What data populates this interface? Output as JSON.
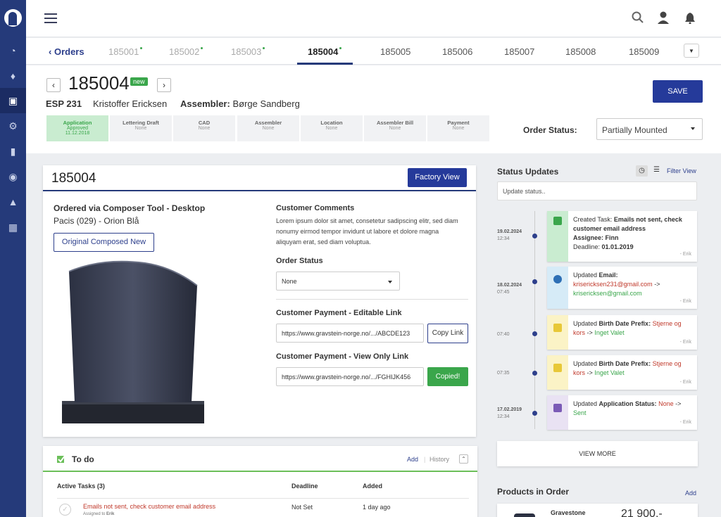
{
  "topbar": {
    "menu_icon": "hamburger-icon",
    "icons": [
      "search-icon",
      "user-icon",
      "bell-icon"
    ]
  },
  "sidebar": {
    "icons": [
      "dashboard-icon",
      "bell-icon",
      "cart-icon",
      "settings-icon",
      "book-icon",
      "support-icon",
      "box-icon",
      "building-icon"
    ]
  },
  "tabs": {
    "back_label": "Orders",
    "items": [
      "185001",
      "185002",
      "185003",
      "185004",
      "185005",
      "185006",
      "185007",
      "185008",
      "185009"
    ],
    "active": "185004"
  },
  "header": {
    "order_id": "185004",
    "badge": "new",
    "product_code": "ESP 231",
    "customer": "Kristoffer Ericksen",
    "assembler_label": "Assembler:",
    "assembler_name": "Børge Sandberg",
    "save_label": "SAVE",
    "order_status_label": "Order Status:",
    "order_status_value": "Partially Mounted",
    "steps": [
      {
        "title": "Application",
        "status": "Approved",
        "date": "11.12.2018"
      },
      {
        "title": "Lettering Draft",
        "status": "None"
      },
      {
        "title": "CAD",
        "status": "None"
      },
      {
        "title": "Assembler",
        "status": "None"
      },
      {
        "title": "Location",
        "status": "None"
      },
      {
        "title": "Assembler Bill",
        "status": "None"
      },
      {
        "title": "Payment",
        "status": "None"
      }
    ]
  },
  "card": {
    "order_id": "185004",
    "factory_view": "Factory View",
    "ordered_via": "Ordered via Composer Tool - Desktop",
    "product": "Pacis (029) - Orion Blå",
    "original_btn": "Original Composed New",
    "comments_title": "Customer Comments",
    "comments_text": "Lorem ipsum dolor sit amet, consetetur sadipscing elitr, sed diam nonumy eirmod tempor invidunt ut labore et dolore magna aliquyam erat, sed diam voluptua.",
    "order_status_title": "Order Status",
    "order_status_value": "None",
    "editable_title": "Customer Payment - Editable Link",
    "editable_link": "https://www.gravstein-norge.no/.../ABCDE123",
    "copy_link": "Copy Link",
    "viewonly_title": "Customer Payment - View Only Link",
    "viewonly_link": "https://www.gravstein-norge.no/.../FGHIJK456",
    "copied": "Copied!"
  },
  "todo": {
    "title": "To do",
    "add": "Add",
    "history": "History",
    "col_tasks": "Active Tasks (3)",
    "col_deadline": "Deadline",
    "col_added": "Added",
    "row": {
      "task": "Emails not sent, check customer email address",
      "assigned_prefix": "Assigned to",
      "assignee": "Erik",
      "deadline": "Not Set",
      "added": "1 day ago"
    }
  },
  "status_updates": {
    "title": "Status Updates",
    "filter": "Filter View",
    "placeholder": "Update status..",
    "view_more": "VIEW MORE",
    "entries": [
      {
        "date": "19.02.2024",
        "time": "12:34",
        "color": "#c9ecd0",
        "icon_color": "#3aa64b",
        "line1_prefix": "Created Task:",
        "line1_bold": "Emails not sent, check customer email address",
        "assignee_label": "Assignee:",
        "assignee": "Finn",
        "deadline_label": "Deadline:",
        "deadline": "01.01.2019",
        "by": "- Erik"
      },
      {
        "date": "18.02.2024",
        "time": "07:45",
        "color": "#d6ebf7",
        "icon_color": "#2d6fb5",
        "prefix": "Updated",
        "field": "Email:",
        "old": "krisericksen231@gmail.com",
        "arrow": "->",
        "new": "krisericksen@gmail.com",
        "by": "- Erik"
      },
      {
        "time": "07:40",
        "color": "#fbf3c6",
        "icon_color": "#e8c838",
        "prefix": "Updated",
        "field": "Birth Date Prefix:",
        "old": "Stjerne og kors",
        "arrow": "->",
        "new": "Inget Valet",
        "by": "- Erik"
      },
      {
        "time": "07:35",
        "color": "#fbf3c6",
        "icon_color": "#e8c838",
        "prefix": "Updated",
        "field": "Birth Date Prefix:",
        "old": "Stjerne og kors",
        "arrow": "->",
        "new": "Inget Valet",
        "by": "- Erik"
      },
      {
        "date": "17.02.2019",
        "time": "12:34",
        "color": "#e9e2f3",
        "icon_color": "#7b5bb6",
        "prefix": "Updated",
        "field": "Application Status:",
        "old": "None",
        "arrow": "->",
        "new": "Sent",
        "by": "- Erik"
      }
    ]
  },
  "products": {
    "title": "Products in Order",
    "add": "Add",
    "item_name": "Gravestone",
    "item_price": "21 900,-"
  },
  "colors": {
    "brand": "#253a7a",
    "accent_green": "#3aa64b",
    "primary_button": "#253a9a"
  }
}
